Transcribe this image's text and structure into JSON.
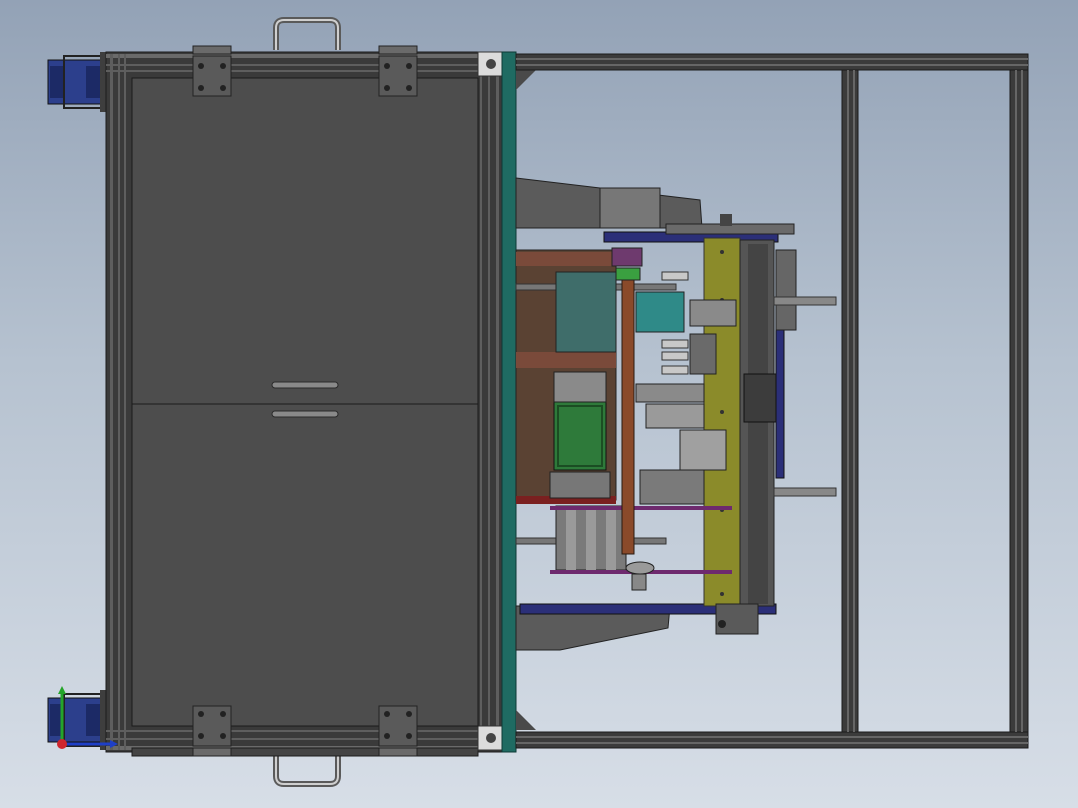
{
  "viewport": {
    "view": "top-view",
    "colors": {
      "background_top": "#93a2b6",
      "background_bottom": "#d7dee7",
      "frame": "#3b3b3b",
      "door_panel": "#4d4d4d",
      "teal_plate": "#1f6b62",
      "olive_plate": "#8b8b2a",
      "brown_plate": "#6e4a35",
      "navy_rail": "#2b2f78",
      "green_motor": "#2e7a3a",
      "caster_blue": "#2c3f8c"
    }
  },
  "triad": {
    "axes": [
      "x",
      "y",
      "z"
    ],
    "colors": {
      "x": "#1e3fc8",
      "y": "#24a52a",
      "z": "#d0262e"
    }
  }
}
